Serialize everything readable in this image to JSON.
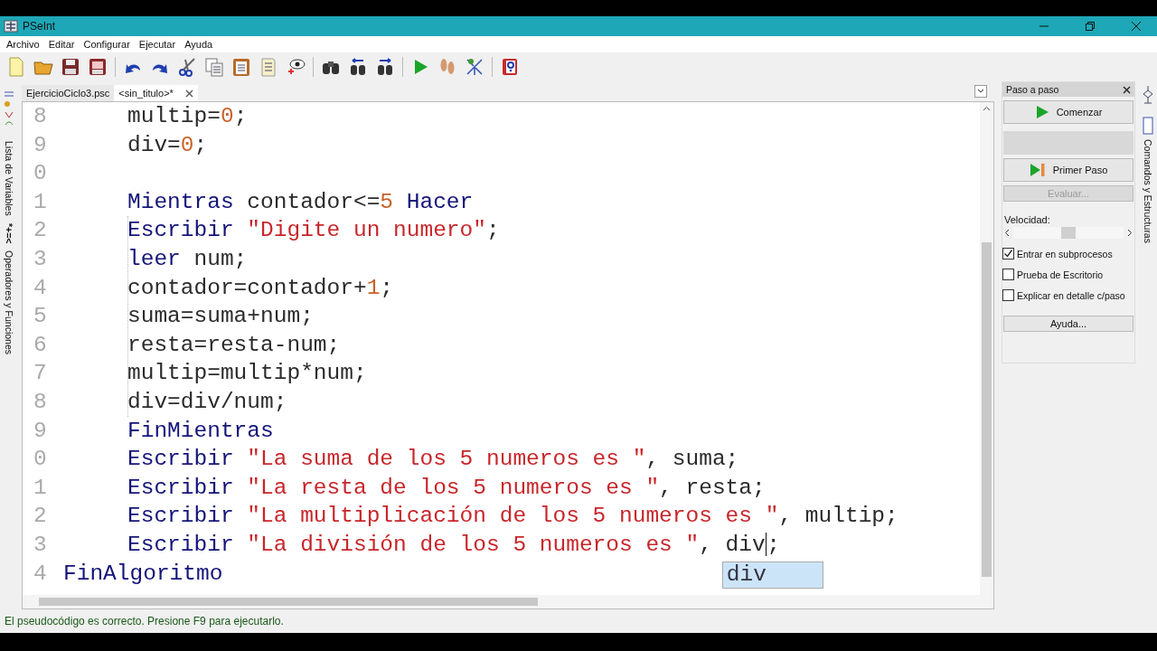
{
  "window": {
    "title": "PSeInt"
  },
  "menu": [
    "Archivo",
    "Editar",
    "Configurar",
    "Ejecutar",
    "Ayuda"
  ],
  "tabs": [
    {
      "label": "EjercicioCiclo3.psc",
      "selected": false,
      "closable": false
    },
    {
      "label": "<sin_titulo>*",
      "selected": true,
      "closable": true
    }
  ],
  "left_strip": [
    "Lista de Variables",
    "*+=<",
    "Operadores y Funciones"
  ],
  "editor": {
    "body": [
      {
        "number": "8",
        "tokens": [
          {
            "kind": "identifier",
            "text": "multip="
          },
          {
            "kind": "number",
            "text": "0"
          },
          {
            "kind": "identifier",
            "text": ";"
          }
        ]
      },
      {
        "number": "9",
        "tokens": [
          {
            "kind": "identifier",
            "text": "div="
          },
          {
            "kind": "number",
            "text": "0"
          },
          {
            "kind": "identifier",
            "text": ";"
          }
        ]
      },
      {
        "number": "0"
      },
      {
        "number": "1",
        "tokens": [
          {
            "kind": "keyword",
            "text": "Mientras"
          },
          {
            "kind": "identifier",
            "text": " contador<="
          },
          {
            "kind": "number",
            "text": "5"
          },
          {
            "kind": "keyword",
            "text": " Hacer"
          }
        ],
        "children": [
          {
            "number": "2",
            "tokens": [
              {
                "kind": "keyword",
                "text": "Escribir "
              },
              {
                "kind": "string",
                "text": "\"Digite un numero\""
              },
              {
                "kind": "identifier",
                "text": ";"
              }
            ]
          },
          {
            "number": "3",
            "tokens": [
              {
                "kind": "keyword",
                "text": "leer"
              },
              {
                "kind": "identifier",
                "text": " num;"
              }
            ]
          },
          {
            "number": "4",
            "tokens": [
              {
                "kind": "identifier",
                "text": "contador=contador+"
              },
              {
                "kind": "number",
                "text": "1"
              },
              {
                "kind": "identifier",
                "text": ";"
              }
            ]
          },
          {
            "number": "5",
            "tokens": [
              {
                "kind": "identifier",
                "text": "suma=suma+num;"
              }
            ]
          },
          {
            "number": "6",
            "tokens": [
              {
                "kind": "identifier",
                "text": "resta=resta-num;"
              }
            ]
          },
          {
            "number": "7",
            "tokens": [
              {
                "kind": "identifier",
                "text": "multip=multip*num;"
              }
            ]
          },
          {
            "number": "8",
            "tokens": [
              {
                "kind": "identifier",
                "text": "div=div/num;"
              }
            ]
          }
        ]
      },
      {
        "number": "9",
        "tokens": [
          {
            "kind": "keyword",
            "text": "FinMientras"
          }
        ]
      },
      {
        "number": "0",
        "tokens": [
          {
            "kind": "keyword",
            "text": "Escribir "
          },
          {
            "kind": "string",
            "text": "\"La suma de los 5 numeros es \""
          },
          {
            "kind": "identifier",
            "text": ", suma;"
          }
        ]
      },
      {
        "number": "1",
        "tokens": [
          {
            "kind": "keyword",
            "text": "Escribir "
          },
          {
            "kind": "string",
            "text": "\"La resta de los 5 numeros es \""
          },
          {
            "kind": "identifier",
            "text": ", resta;"
          }
        ]
      },
      {
        "number": "2",
        "tokens": [
          {
            "kind": "keyword",
            "text": "Escribir "
          },
          {
            "kind": "string",
            "text": "\"La multiplicación de los 5 numeros es \""
          },
          {
            "kind": "identifier",
            "text": ", multip;"
          }
        ]
      },
      {
        "number": "3",
        "tokens": [
          {
            "kind": "keyword",
            "text": "Escribir "
          },
          {
            "kind": "string",
            "text": "\"La división de los 5 numeros es \""
          },
          {
            "kind": "identifier",
            "text": ", div"
          },
          {
            "kind": "caret"
          },
          {
            "kind": "identifier",
            "text": ";"
          }
        ]
      }
    ],
    "closing": {
      "number": "4",
      "tokens": [
        {
          "kind": "keyword",
          "text": "FinAlgoritmo"
        }
      ]
    },
    "autocomplete": [
      {
        "text": "div",
        "selected": true
      }
    ]
  },
  "step_panel": {
    "title": "Paso a paso",
    "start_button": "Comenzar",
    "first_step_button": "Primer Paso",
    "evaluate_button": {
      "label": "Evaluar...",
      "disabled": true
    },
    "speed_label": "Velocidad:",
    "speed": {
      "level": 0.5
    },
    "options": [
      {
        "label": "Entrar en subprocesos",
        "checked": true
      },
      {
        "label": "Prueba de Escritorio",
        "checked": false
      },
      {
        "label": "Explicar en detalle c/paso",
        "checked": false
      }
    ],
    "help_button": "Ayuda..."
  },
  "right_strip": "Comandos y Estructuras",
  "status_bar": "El pseudocódigo es correcto. Presione F9 para ejecutarlo."
}
